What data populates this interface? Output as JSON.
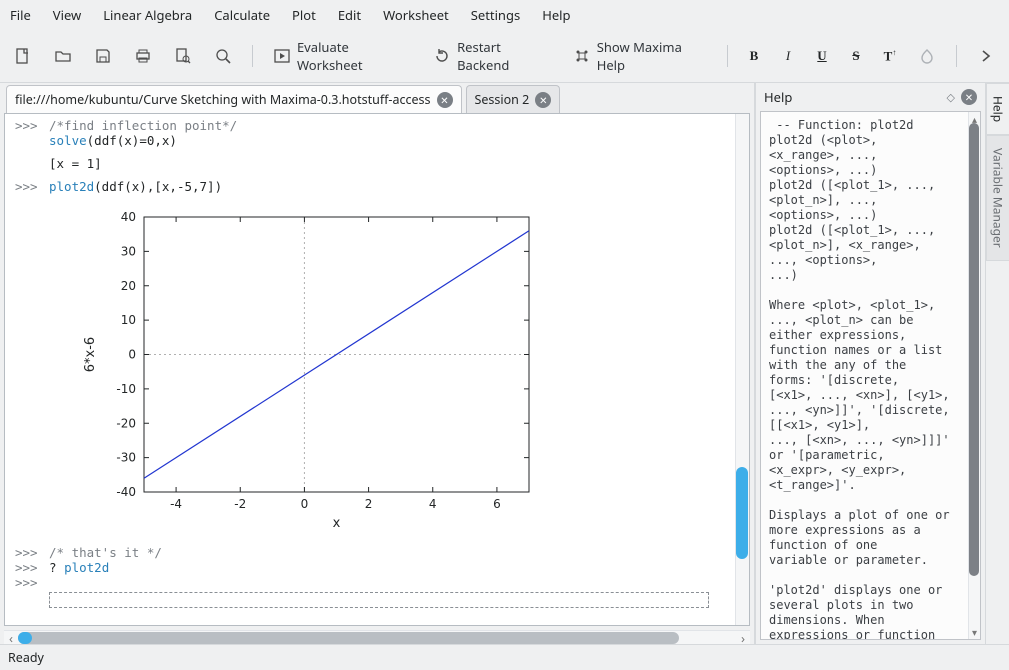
{
  "menu": [
    "File",
    "View",
    "Linear Algebra",
    "Calculate",
    "Plot",
    "Edit",
    "Worksheet",
    "Settings",
    "Help"
  ],
  "toolbar": {
    "evaluate": "Evaluate Worksheet",
    "restart": "Restart Backend",
    "maximahelp": "Show Maxima Help"
  },
  "tabs": {
    "t1": "file:///home/kubuntu/Curve Sketching with Maxima-0.3.hotstuff-access",
    "t2": "Session 2"
  },
  "worksheet": {
    "prompt": ">>>",
    "c1_comment": "/*find inflection point*/",
    "c1_code_a": "solve",
    "c1_code_b": "(ddf(x)=0,x)",
    "c1_out": "[x = 1]",
    "c2_code_a": "plot2d",
    "c2_code_b": "(ddf(x),[x,-5,7])",
    "c3_code": "/* that's it */",
    "c4_a": "? ",
    "c4_b": "plot2d"
  },
  "chart_data": {
    "type": "line",
    "xlabel": "x",
    "ylabel": "6*x-6",
    "xlim": [
      -5,
      7
    ],
    "ylim": [
      -40,
      40
    ],
    "xticks": [
      -4,
      -2,
      0,
      2,
      4,
      6
    ],
    "yticks": [
      -40,
      -30,
      -20,
      -10,
      0,
      10,
      20,
      30,
      40
    ],
    "series": [
      {
        "name": "6*x-6",
        "points": [
          [
            -5,
            -36
          ],
          [
            7,
            36
          ]
        ]
      }
    ],
    "grid_zero_only": true
  },
  "help": {
    "title": "Help",
    "body": " -- Function: plot2d\nplot2d (<plot>,\n<x_range>, ...,\n<options>, ...)\nplot2d ([<plot_1>, ...,\n<plot_n>], ...,\n<options>, ...)\nplot2d ([<plot_1>, ...,\n<plot_n>], <x_range>,\n..., <options>,\n...)\n\nWhere <plot>, <plot_1>,\n..., <plot_n> can be\neither expressions,\nfunction names or a list\nwith the any of the\nforms: '[discrete,\n[<x1>, ..., <xn>], [<y1>,\n..., <yn>]]', '[discrete,\n[[<x1>, <y1>],\n..., [<xn>, ..., <yn>]]]'\nor '[parametric,\n<x_expr>, <y_expr>,\n<t_range>]'.\n\nDisplays a plot of one or\nmore expressions as a\nfunction of one\nvariable or parameter.\n\n'plot2d' displays one or\nseveral plots in two\ndimensions. When\nexpressions or function"
  },
  "rail": {
    "help": "Help",
    "varmgr": "Variable Manager"
  },
  "status": "Ready"
}
